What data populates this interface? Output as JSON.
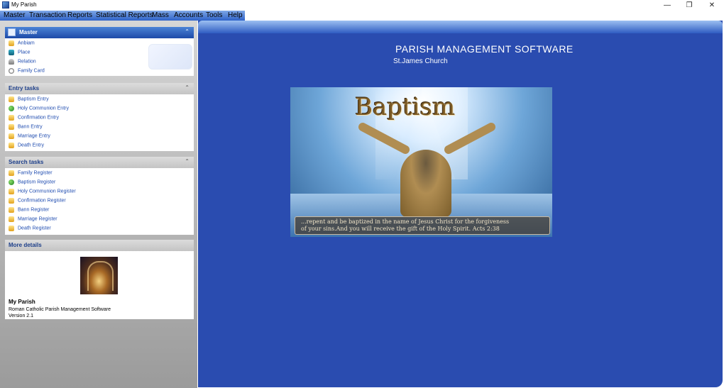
{
  "window": {
    "title": "My Parish",
    "min": "—",
    "max": "❐",
    "close": "✕"
  },
  "menu": [
    "Master",
    "Transaction",
    "Reports",
    "Statistical Reports",
    "Mass",
    "Accounts",
    "Tools",
    "Help"
  ],
  "colors": {
    "accent": "#2a4cb0",
    "link": "#1f4cb0"
  },
  "master": {
    "title": "Master",
    "items": [
      {
        "label": "Anbiam",
        "icon": "folder-icon"
      },
      {
        "label": "Place",
        "icon": "globe-icon"
      },
      {
        "label": "Relation",
        "icon": "person-icon"
      },
      {
        "label": "Family Card",
        "icon": "clock-icon"
      }
    ]
  },
  "entry": {
    "title": "Entry tasks",
    "items": [
      {
        "label": "Baptism Entry",
        "icon": "folder-icon"
      },
      {
        "label": "Holy Communion Entry",
        "icon": "globe-icon"
      },
      {
        "label": "Confirmation Entry",
        "icon": "folder-icon"
      },
      {
        "label": "Bann Entry",
        "icon": "folder-icon"
      },
      {
        "label": "Marriage Entry",
        "icon": "folder-icon"
      },
      {
        "label": "Death Entry",
        "icon": "folder-icon"
      }
    ]
  },
  "search": {
    "title": "Search tasks",
    "items": [
      {
        "label": "Family Register",
        "icon": "folder-icon"
      },
      {
        "label": "Baptism Register",
        "icon": "globe-icon"
      },
      {
        "label": "Holy Communion Register",
        "icon": "folder-icon"
      },
      {
        "label": "Confirmation Register",
        "icon": "folder-icon"
      },
      {
        "label": "Bann Register",
        "icon": "folder-icon"
      },
      {
        "label": "Marriage Register",
        "icon": "folder-icon"
      },
      {
        "label": "Death Register",
        "icon": "folder-icon"
      }
    ]
  },
  "more": {
    "title": "More details",
    "app_name": "My Parish",
    "description": "Roman Catholic Parish Management Software",
    "version": "Version 2.1"
  },
  "main": {
    "title": "PARISH MANAGEMENT SOFTWARE",
    "church": "St.James Church",
    "banner_title": "Baptism",
    "caption_line1": "...repent and be baptized in the name of Jesus Christ for the forgiveness",
    "caption_line2": "of your sins.And you will receive the gift of the Holy Spirit.  Acts 2:38"
  }
}
